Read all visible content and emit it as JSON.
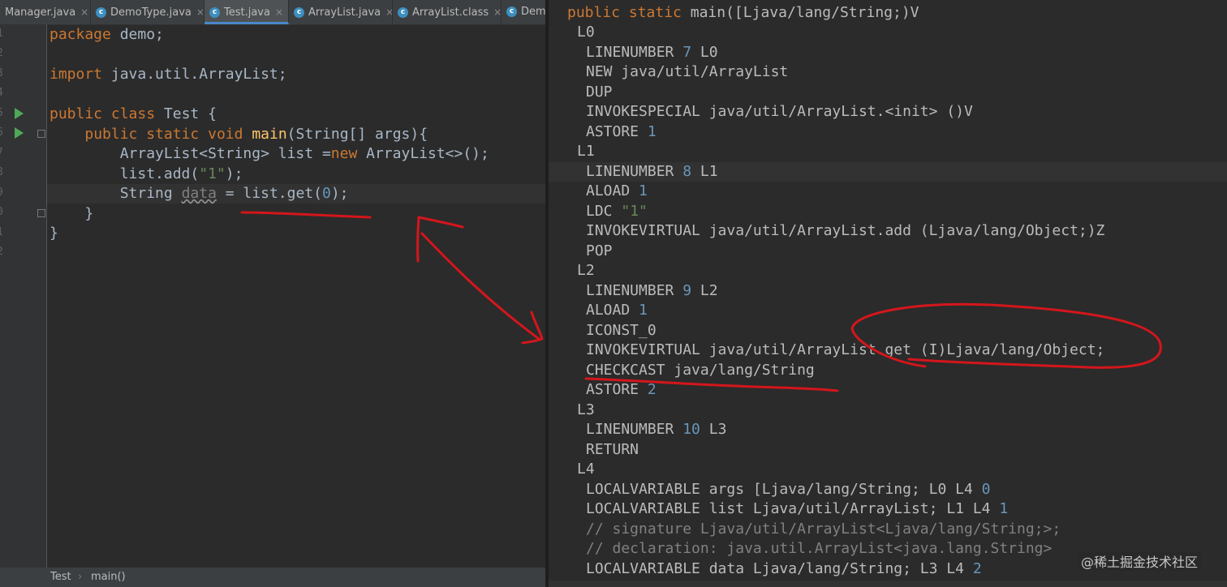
{
  "tabs": [
    {
      "label": "Manager.java",
      "has_icon": false
    },
    {
      "label": "DemoType.java",
      "has_icon": true
    },
    {
      "label": "Test.java",
      "has_icon": true,
      "active": true
    },
    {
      "label": "ArrayList.java",
      "has_icon": true
    },
    {
      "label": "ArrayList.class",
      "has_icon": true
    },
    {
      "label": "Dem",
      "has_icon": true
    }
  ],
  "tab_icon_letter": "c",
  "tab_close_glyph": "×",
  "line_numbers": [
    "1",
    "2",
    "3",
    "4",
    "5",
    "6",
    "7",
    "8",
    "9",
    "0",
    "1",
    "2"
  ],
  "code": {
    "l1_kw": "package",
    "l1_rest": " demo;",
    "l3_kw": "import",
    "l3_rest": " java.util.ArrayList;",
    "l5_kw1": "public",
    "l5_kw2": "class",
    "l5_rest": " Test {",
    "l6_indent": "    ",
    "l6_kw1": "public",
    "l6_kw2": "static",
    "l6_kw3": "void",
    "l6_fn": "main",
    "l6_rest": "(String[] args){",
    "l7_a": "        ArrayList<String> list =",
    "l7_kw": "new",
    "l7_b": " ArrayList<>();",
    "l8_a": "        list.add(",
    "l8_str": "\"1\"",
    "l8_b": ");",
    "l9_a": "        String ",
    "l9_var": "data",
    "l9_b": " = list.get(",
    "l9_num": "0",
    "l9_c": ");",
    "l10": "    }",
    "l11": "}"
  },
  "breadcrumb": {
    "item1": "Test",
    "sep": "›",
    "item2": "main()"
  },
  "bytecode": {
    "header_kw1": "public",
    "header_kw2": "static",
    "header_rest": " main([Ljava/lang/String;)V",
    "L0": "L0",
    "ln7_a": "LINENUMBER ",
    "ln7_n": "7",
    "ln7_b": " L0",
    "new": "NEW java/util/ArrayList",
    "dup": "DUP",
    "invspec": "INVOKESPECIAL java/util/ArrayList.<init> ()V",
    "astore1_a": "ASTORE ",
    "astore1_n": "1",
    "L1": "L1",
    "ln8_a": "LINENUMBER ",
    "ln8_n": "8",
    "ln8_b": " L1",
    "aload1_a": "ALOAD ",
    "aload1_n": "1",
    "ldc_a": "LDC ",
    "ldc_s": "\"1\"",
    "invadd": "INVOKEVIRTUAL java/util/ArrayList.add (Ljava/lang/Object;)Z",
    "pop": "POP",
    "L2": "L2",
    "ln9_a": "LINENUMBER ",
    "ln9_n": "9",
    "ln9_b": " L2",
    "aload1b_a": "ALOAD ",
    "aload1b_n": "1",
    "iconst": "ICONST_0",
    "invget": "INVOKEVIRTUAL java/util/ArrayList.get (I)Ljava/lang/Object;",
    "checkcast": "CHECKCAST java/lang/String",
    "astore2_a": "ASTORE ",
    "astore2_n": "2",
    "L3": "L3",
    "ln10_a": "LINENUMBER ",
    "ln10_n": "10",
    "ln10_b": " L3",
    "ret": "RETURN",
    "L4": "L4",
    "lv1_a": "LOCALVARIABLE args [Ljava/lang/String; L0 L4 ",
    "lv1_n": "0",
    "lv2_a": "LOCALVARIABLE list Ljava/util/ArrayList; L1 L4 ",
    "lv2_n": "1",
    "cm1": "// signature Ljava/util/ArrayList<Ljava/lang/String;>;",
    "cm2": "// declaration: java.util.ArrayList<java.lang.String>",
    "lv3_a": "LOCALVARIABLE data Ljava/lang/String; L3 L4 ",
    "lv3_n": "2"
  },
  "watermark": "@稀土掘金技术社区",
  "colors": {
    "background": "#2b2b2b",
    "keyword": "#cc7832",
    "function": "#ffc66d",
    "string": "#6a8759",
    "number": "#6897bb",
    "annotation": "#d4161c"
  }
}
